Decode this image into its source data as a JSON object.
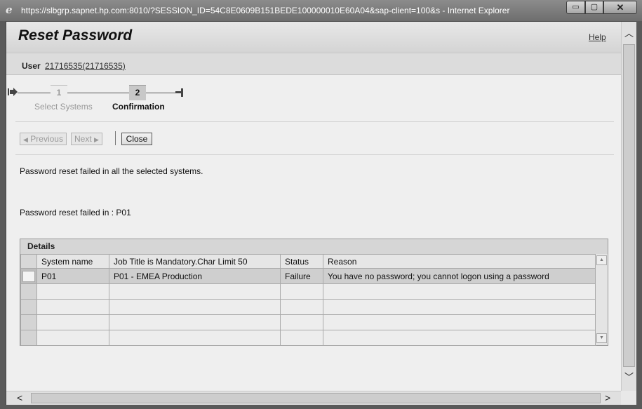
{
  "window": {
    "title": "https://slbgrp.sapnet.hp.com:8010/?SESSION_ID=54C8E0609B151BEDE100000010E60A04&sap-client=100&s - Internet Explorer",
    "min_glyph": "▭",
    "max_glyph": "▢",
    "close_glyph": "✕",
    "browser_icon": "e"
  },
  "header": {
    "title": "Reset Password",
    "help": "Help"
  },
  "user": {
    "label": "User",
    "value": "21716535(21716535)"
  },
  "roadmap": {
    "steps": [
      {
        "number": "1",
        "label": "Select Systems",
        "state": "inactive"
      },
      {
        "number": "2",
        "label": "Confirmation",
        "state": "active"
      }
    ]
  },
  "toolbar": {
    "previous": "Previous",
    "next": "Next",
    "close": "Close"
  },
  "messages": {
    "line1": "Password reset failed in all the selected systems.",
    "line2": "Password reset failed in : P01"
  },
  "details": {
    "title": "Details",
    "columns": [
      "System name",
      "Job Title is Mandatory.Char Limit 50",
      "Status",
      "Reason"
    ],
    "rows": [
      [
        "P01",
        "P01 - EMEA Production",
        "Failure",
        "You have no password; you cannot logon using a password"
      ]
    ]
  },
  "icons": {
    "roadmap_start": "arrow-right-icon",
    "roadmap_end": "end-marker-icon",
    "scroll_up": "chevron-up-icon",
    "scroll_down": "chevron-down-icon",
    "scroll_left": "chevron-left-icon",
    "scroll_right": "chevron-right-icon"
  }
}
